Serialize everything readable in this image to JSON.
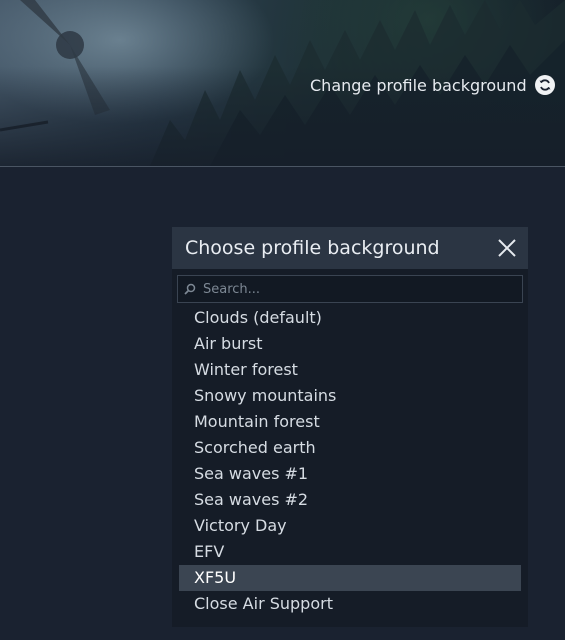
{
  "banner": {
    "change_label": "Change profile background",
    "refresh_icon": "refresh-icon"
  },
  "panel": {
    "title": "Choose profile background",
    "close_icon": "close-icon",
    "search": {
      "placeholder": "Search...",
      "value": "",
      "icon": "search-icon"
    },
    "items": [
      {
        "label": "Clouds (default)",
        "selected": false
      },
      {
        "label": "Air burst",
        "selected": false
      },
      {
        "label": "Winter forest",
        "selected": false
      },
      {
        "label": "Snowy mountains",
        "selected": false
      },
      {
        "label": "Mountain forest",
        "selected": false
      },
      {
        "label": "Scorched earth",
        "selected": false
      },
      {
        "label": "Sea waves #1",
        "selected": false
      },
      {
        "label": "Sea waves #2",
        "selected": false
      },
      {
        "label": "Victory Day",
        "selected": false
      },
      {
        "label": "EFV",
        "selected": false
      },
      {
        "label": "XF5U",
        "selected": true
      },
      {
        "label": "Close Air Support",
        "selected": false
      }
    ]
  },
  "colors": {
    "background": "#1a2230",
    "header": "#2b3543",
    "selected_row": "#3b4552",
    "text": "#d6dce3"
  }
}
